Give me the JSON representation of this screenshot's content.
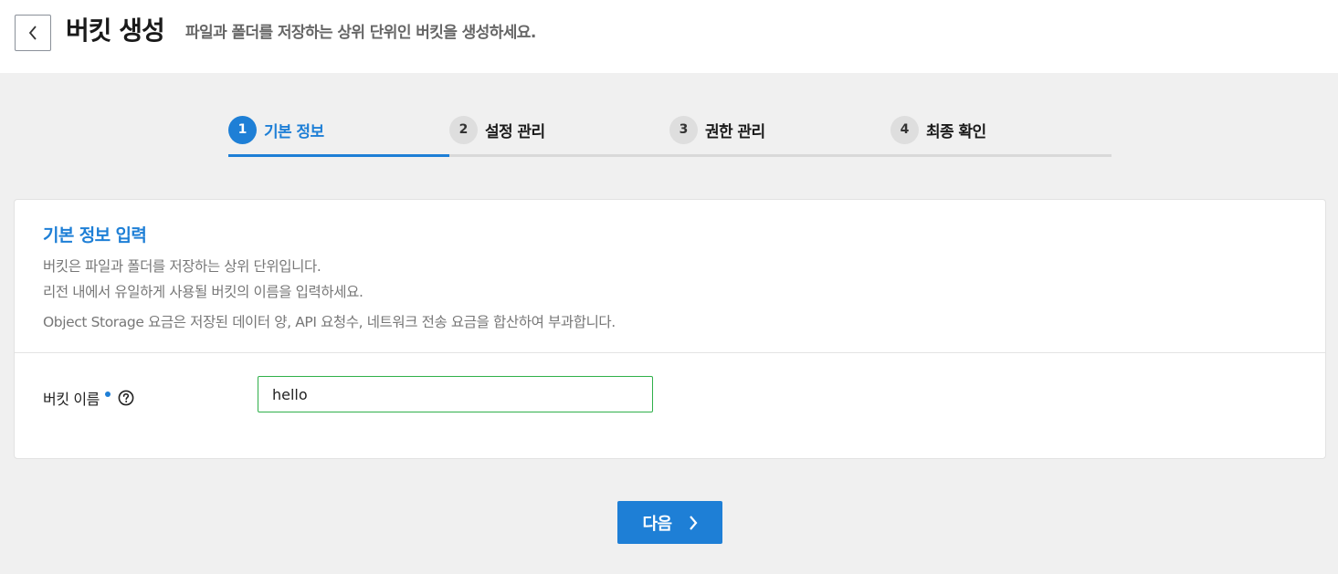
{
  "header": {
    "title": "버킷 생성",
    "subtitle": "파일과 폴더를 저장하는 상위 단위인 버킷을 생성하세요."
  },
  "steps": [
    {
      "number": "1",
      "label": "기본 정보",
      "active": true
    },
    {
      "number": "2",
      "label": "설정 관리",
      "active": false
    },
    {
      "number": "3",
      "label": "권한 관리",
      "active": false
    },
    {
      "number": "4",
      "label": "최종 확인",
      "active": false
    }
  ],
  "basic_info": {
    "title": "기본 정보 입력",
    "desc_line1": "버킷은 파일과 폴더를 저장하는 상위 단위입니다.",
    "desc_line2": "리전 내에서 유일하게 사용될 버킷의 이름을 입력하세요.",
    "desc_line3": "Object Storage 요금은 저장된 데이터 양, API 요청수, 네트워크 전송 요금을 합산하여 부과합니다.",
    "field_label": "버킷 이름",
    "field_value": "hello"
  },
  "footer": {
    "next_label": "다음"
  },
  "colors": {
    "accent": "#1e7fd6",
    "input_border_valid": "#2fb04a",
    "background": "#f0f0f0"
  },
  "icons": {
    "back": "chevron-left-icon",
    "help": "question-circle-icon",
    "next": "chevron-right-icon"
  }
}
